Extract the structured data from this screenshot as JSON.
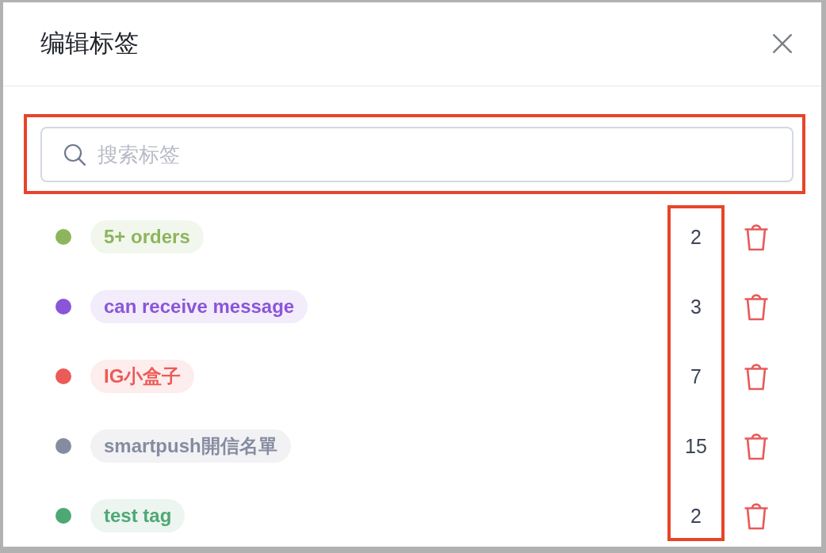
{
  "dialog": {
    "title": "编辑标签"
  },
  "search": {
    "placeholder": "搜索标签",
    "highlighted": true
  },
  "tags": [
    {
      "name": "5+ orders",
      "color": "#8db55d",
      "count": "2"
    },
    {
      "name": "can receive message",
      "color": "#8b55d9",
      "count": "3"
    },
    {
      "name": "IG小盒子",
      "color": "#eb5b57",
      "count": "7"
    },
    {
      "name": "smartpush開信名單",
      "color": "#868ca0",
      "count": "15"
    },
    {
      "name": "test tag",
      "color": "#4ea874",
      "count": "2"
    }
  ],
  "count_column_highlighted": true
}
